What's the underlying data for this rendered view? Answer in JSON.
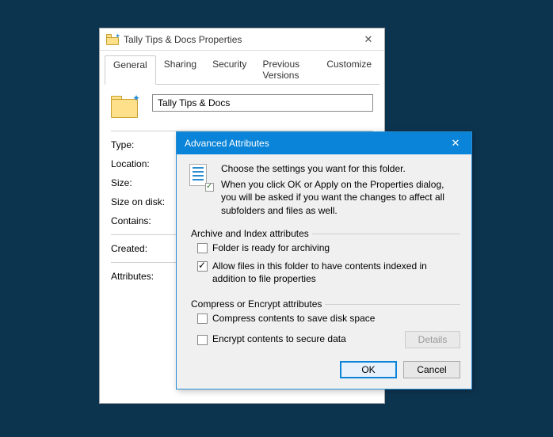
{
  "properties": {
    "title": "Tally Tips & Docs Properties",
    "tabs": [
      "General",
      "Sharing",
      "Security",
      "Previous Versions",
      "Customize"
    ],
    "folder_name": "Tally Tips & Docs",
    "fields": {
      "type": "Type:",
      "location": "Location:",
      "size": "Size:",
      "size_on_disk": "Size on disk:",
      "contains": "Contains:",
      "created": "Created:",
      "attributes": "Attributes:"
    }
  },
  "advanced": {
    "title": "Advanced Attributes",
    "intro_line1": "Choose the settings you want for this folder.",
    "intro_line2": "When you click OK or Apply on the Properties dialog, you will be asked if you want the changes to affect all subfolders and files as well.",
    "groups": {
      "archive": {
        "label": "Archive and Index attributes",
        "folder_ready": {
          "text": "Folder is ready for archiving",
          "checked": false
        },
        "allow_index": {
          "text": "Allow files in this folder to have contents indexed in addition to file properties",
          "checked": true
        }
      },
      "compress": {
        "label": "Compress or Encrypt attributes",
        "compress": {
          "text": "Compress contents to save disk space",
          "checked": false
        },
        "encrypt": {
          "text": "Encrypt contents to secure data",
          "checked": false
        },
        "details_label": "Details"
      }
    },
    "buttons": {
      "ok": "OK",
      "cancel": "Cancel"
    }
  }
}
